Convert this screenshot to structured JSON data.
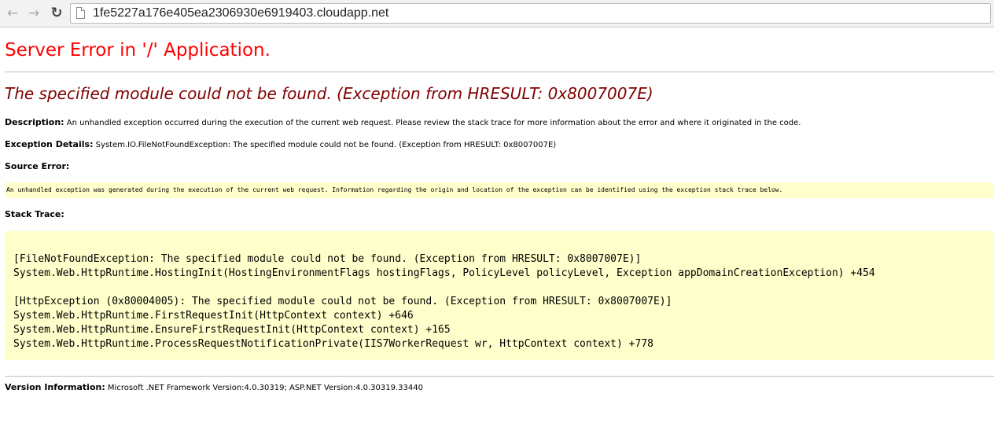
{
  "browser": {
    "back_glyph": "←",
    "forward_glyph": "→",
    "reload_glyph": "↻",
    "url": "1fe5227a176e405ea2306930e6919403.cloudapp.net"
  },
  "page": {
    "title": "Server Error in '/' Application.",
    "error_message": "The specified module could not be found. (Exception from HRESULT: 0x8007007E)",
    "description_label": "Description:",
    "description_text": "An unhandled exception occurred during the execution of the current web request. Please review the stack trace for more information about the error and where it originated in the code.",
    "exception_details_label": "Exception Details:",
    "exception_details_text": "System.IO.FileNotFoundException: The specified module could not be found. (Exception from HRESULT: 0x8007007E)",
    "source_error_label": "Source Error:",
    "source_error_text": "An unhandled exception was generated during the execution of the current web request. Information regarding the origin and location of the exception can be identified using the exception stack trace below.",
    "stack_trace_label": "Stack Trace:",
    "stack_trace_lines": [
      "[FileNotFoundException: The specified module could not be found. (Exception from HRESULT: 0x8007007E)]",
      "   System.Web.HttpRuntime.HostingInit(HostingEnvironmentFlags hostingFlags, PolicyLevel policyLevel, Exception appDomainCreationException) +454",
      "[HttpException (0x80004005): The specified module could not be found. (Exception from HRESULT: 0x8007007E)]",
      "   System.Web.HttpRuntime.FirstRequestInit(HttpContext context) +646",
      "   System.Web.HttpRuntime.EnsureFirstRequestInit(HttpContext context) +165",
      "   System.Web.HttpRuntime.ProcessRequestNotificationPrivate(IIS7WorkerRequest wr, HttpContext context) +778"
    ],
    "version_label": "Version Information:",
    "version_text": "Microsoft .NET Framework Version:4.0.30319; ASP.NET Version:4.0.30319.33440"
  },
  "colors": {
    "title": "#ff0000",
    "error_message": "#800000",
    "code_background": "#ffffcc"
  }
}
